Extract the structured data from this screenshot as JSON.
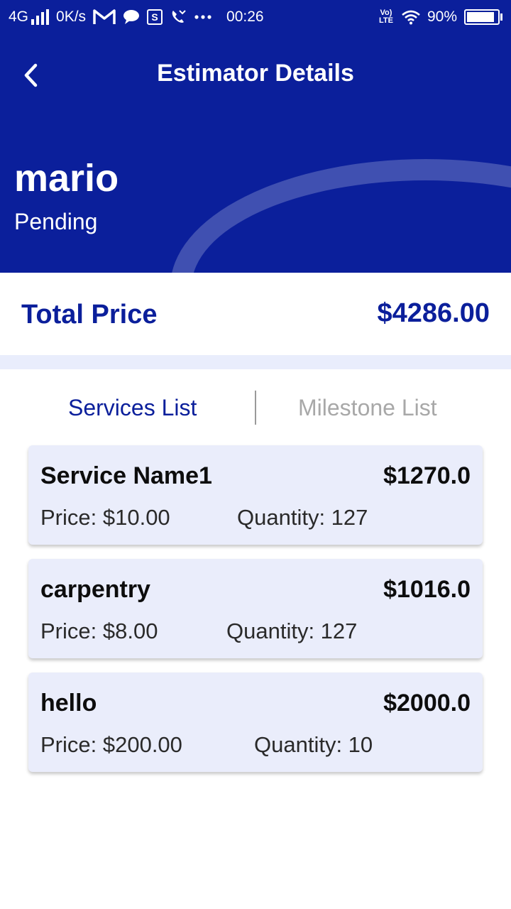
{
  "status_bar": {
    "network": "4G",
    "speed": "0K/s",
    "time": "00:26",
    "volte": "Vo) LTE",
    "battery": "90%",
    "battery_level": 0.9
  },
  "header": {
    "title": "Estimator Details",
    "name": "mario",
    "status": "Pending"
  },
  "total": {
    "label": "Total Price",
    "value": "$4286.00"
  },
  "tabs": [
    {
      "label": "Services List",
      "active": true
    },
    {
      "label": "Milestone List",
      "active": false
    }
  ],
  "services": [
    {
      "name": "Service Name1",
      "total": "$1270.0",
      "price": "Price: $10.00",
      "quantity": "Quantity: 127"
    },
    {
      "name": "carpentry",
      "total": "$1016.0",
      "price": "Price: $8.00",
      "quantity": "Quantity: 127"
    },
    {
      "name": "hello",
      "total": "$2000.0",
      "price": "Price: $200.00",
      "quantity": "Quantity: 10"
    }
  ],
  "colors": {
    "primary": "#0b1f9b",
    "card_bg": "#eaedfb",
    "inactive_tab": "#a8a8a8"
  }
}
